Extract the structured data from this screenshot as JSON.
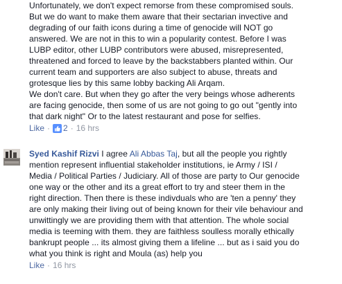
{
  "comment1": {
    "lines": [
      "Unfortunately, we don't expect remorse from these compromised souls.",
      "But we do want to make them aware that their sectarian invective and",
      "degrading of our faith icons during a time of genocide will NOT go",
      "answered. We are not in this to win a popularity contest. Before I was",
      "LUBP editor, other LUBP contributors were abused, misrepresented,",
      "threatened and forced to leave by the backstabbers planted within. Our",
      "current team and supporters are also subject to abuse, threats and",
      "grotesque lies by this same lobby backing Ali Arqam.",
      "We don't care. But when they go after the very beings whose adherents",
      "are facing genocide, then some of us are not going to go out \"gently into",
      "that dark night\" Or to the latest restaurant and pose for selfies."
    ],
    "like_label": "Like",
    "like_count": "2",
    "time": "16 hrs"
  },
  "comment2": {
    "author": "Syed Kashif Rizvi",
    "first_line_pre": " I agree ",
    "mention": "Ali Abbas Taj",
    "first_line_post": ", but all the people you rightly",
    "lines": [
      "mention represent influential stakeholder institutions, ie Army / ISI /",
      "Media / Political Parties / Judiciary. All of those are party to Our genocide",
      "one way or the other and its a great effort to try and steer them in the",
      "right direction. Then there is these indivduals who are 'ten a penny' they",
      "are only making their living out of being known for their vile behaviour and",
      "unwittingly we are providing them with that attention. The whole social",
      "media is teeming with them. they are faithless soulless morally ethically",
      "bankrupt people ... its almost giving them a lifeline ... but as i said you do",
      "what you think is right and Moula (as) help you"
    ],
    "like_label": "Like",
    "time": "16 hrs"
  },
  "icons": {
    "like_count_icon": "thumbs-up-icon",
    "avatar": "profile-avatar"
  },
  "colors": {
    "link": "#365899",
    "meta": "#9197a3",
    "like": "#4e69a2",
    "text": "#141823"
  }
}
